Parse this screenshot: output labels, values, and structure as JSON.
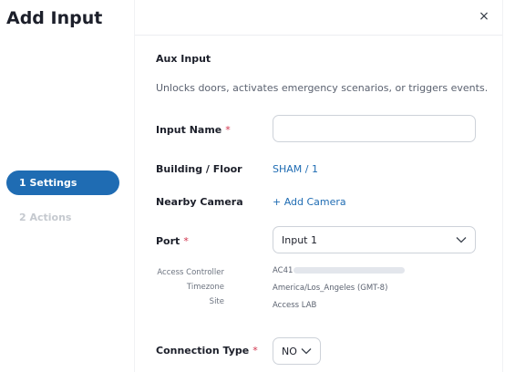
{
  "dialog": {
    "title": "Add Input",
    "close_glyph": "×",
    "close_icon": "close-icon"
  },
  "steps": [
    {
      "label": "1  Settings",
      "state": "active"
    },
    {
      "label": "2  Actions",
      "state": "inactive"
    }
  ],
  "form": {
    "section_title": "Aux Input",
    "section_description": "Unlocks doors, activates emergency scenarios, or triggers events.",
    "required_marker": "*",
    "input_name": {
      "label": "Input Name",
      "value": "",
      "placeholder": ""
    },
    "building_floor": {
      "label": "Building / Floor",
      "value": "SHAM / 1"
    },
    "nearby_camera": {
      "label": "Nearby Camera",
      "action": "+ Add Camera"
    },
    "port": {
      "label": "Port",
      "selected": "Input 1"
    },
    "details": {
      "access_controller": {
        "label": "Access Controller",
        "value": "AC41"
      },
      "timezone": {
        "label": "Timezone",
        "value": "America/Los_Angeles (GMT-8)"
      },
      "site": {
        "label": "Site",
        "value": "Access LAB"
      }
    },
    "connection_type": {
      "label": "Connection Type",
      "selected": "NO"
    }
  },
  "colors": {
    "accent": "#1f6cb3",
    "required": "#d0324b",
    "inactive_step": "#c5c9cf"
  }
}
